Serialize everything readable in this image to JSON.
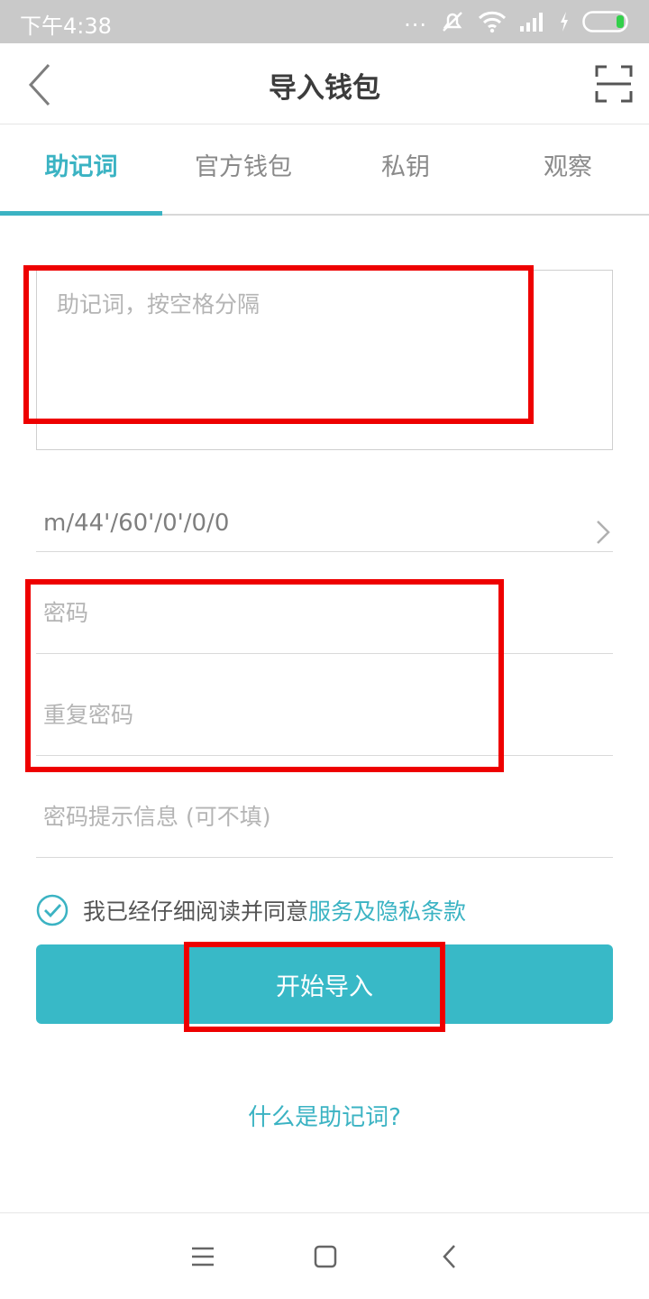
{
  "status_bar": {
    "time": "下午4:38",
    "dots": "..."
  },
  "header": {
    "title": "导入钱包"
  },
  "tabs": [
    {
      "label": "助记词",
      "active": true
    },
    {
      "label": "官方钱包",
      "active": false
    },
    {
      "label": "私钥",
      "active": false
    },
    {
      "label": "观察",
      "active": false
    }
  ],
  "form": {
    "mnemonic_placeholder": "助记词，按空格分隔",
    "derivation_path": "m/44'/60'/0'/0/0",
    "password_placeholder": "密码",
    "repeat_password_placeholder": "重复密码",
    "hint_placeholder": "密码提示信息 (可不填)"
  },
  "agreement": {
    "text": "我已经仔细阅读并同意",
    "link": "服务及隐私条款",
    "checked": true
  },
  "submit_label": "开始导入",
  "help_link": "什么是助记词?",
  "colors": {
    "accent": "#3bb3c3",
    "button": "#38b9c7",
    "annotation": "#ee0000"
  },
  "icons": [
    "back-icon",
    "scan-icon",
    "chevron-right-icon",
    "check-circle-icon",
    "menu-icon",
    "home-icon",
    "back-nav-icon"
  ]
}
